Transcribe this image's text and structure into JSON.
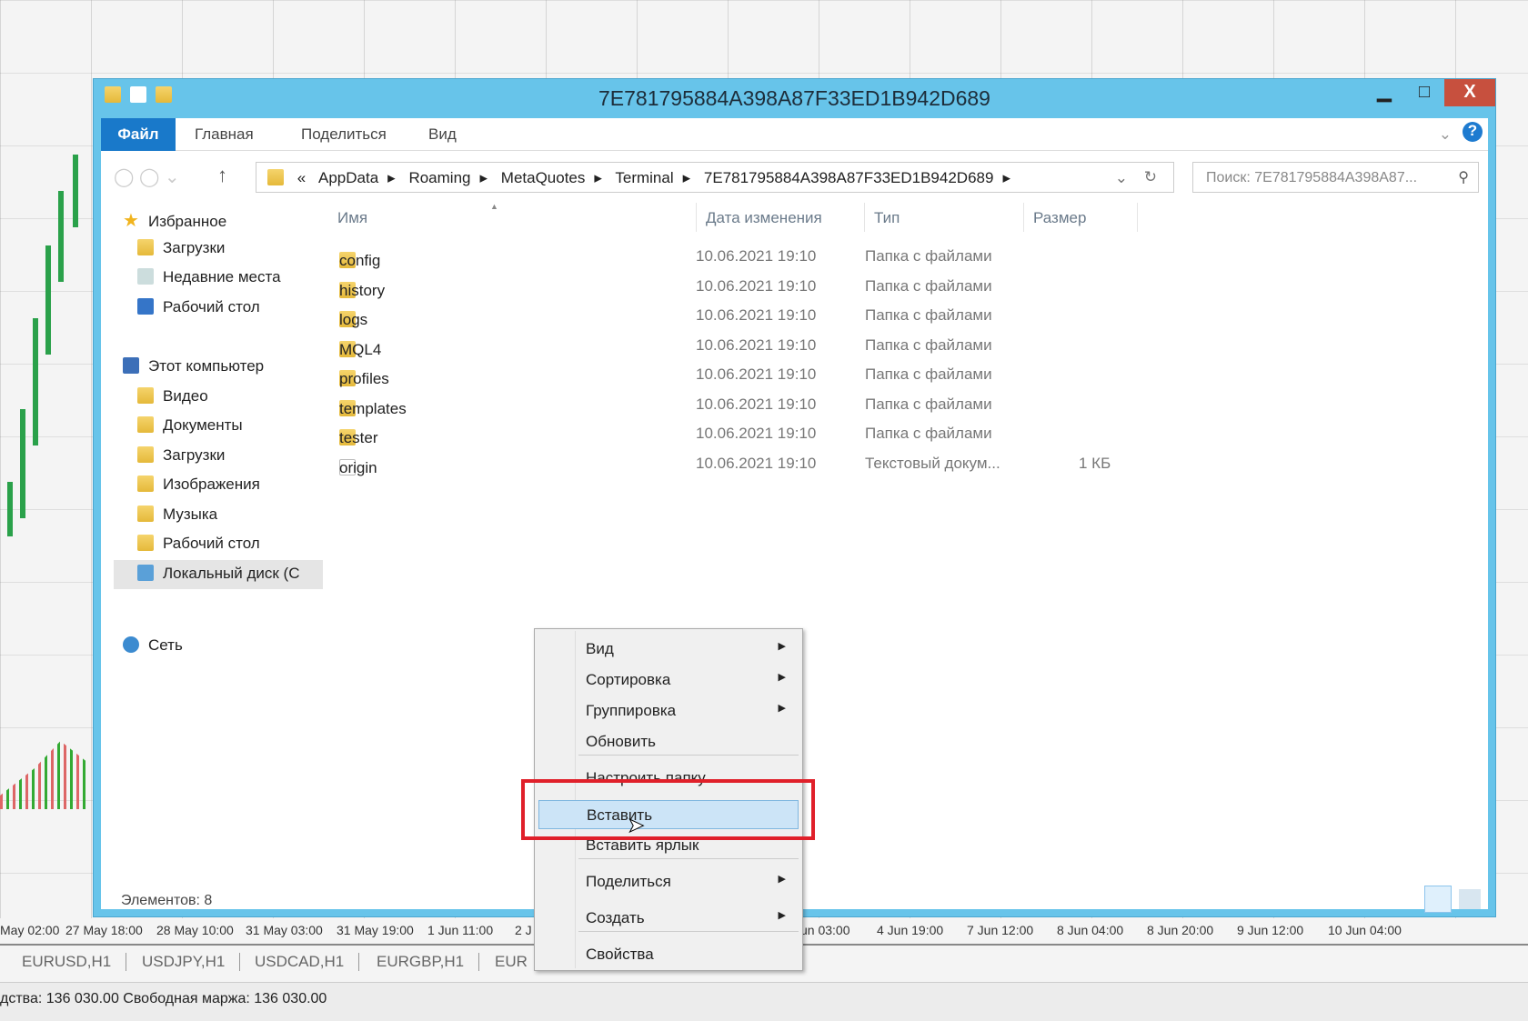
{
  "window": {
    "title": "7E781795884A398A87F33ED1B942D689",
    "minimize": "▁",
    "maximize": "□",
    "close": "X"
  },
  "ribbon": {
    "tabs": [
      "Файл",
      "Главная",
      "Поделиться",
      "Вид"
    ],
    "help": "?"
  },
  "address": {
    "prefix": "«",
    "parts": [
      "AppData",
      "Roaming",
      "MetaQuotes",
      "Terminal",
      "7E781795884A398A87F33ED1B942D689"
    ],
    "search_placeholder": "Поиск: 7E781795884A398A87..."
  },
  "sidebar": {
    "favorites": "Избранное",
    "fav_items": [
      "Загрузки",
      "Недавние места",
      "Рабочий стол"
    ],
    "computer": "Этот компьютер",
    "comp_items": [
      "Видео",
      "Документы",
      "Загрузки",
      "Изображения",
      "Музыка",
      "Рабочий стол",
      "Локальный диск (C"
    ],
    "network": "Сеть"
  },
  "columns": [
    "Имя",
    "Дата изменения",
    "Тип",
    "Размер"
  ],
  "files": [
    {
      "name": "config",
      "date": "10.06.2021 19:10",
      "type": "Папка с файлами",
      "size": "",
      "icon": "folder"
    },
    {
      "name": "history",
      "date": "10.06.2021 19:10",
      "type": "Папка с файлами",
      "size": "",
      "icon": "folder"
    },
    {
      "name": "logs",
      "date": "10.06.2021 19:10",
      "type": "Папка с файлами",
      "size": "",
      "icon": "folder"
    },
    {
      "name": "MQL4",
      "date": "10.06.2021 19:10",
      "type": "Папка с файлами",
      "size": "",
      "icon": "folder"
    },
    {
      "name": "profiles",
      "date": "10.06.2021 19:10",
      "type": "Папка с файлами",
      "size": "",
      "icon": "folder"
    },
    {
      "name": "templates",
      "date": "10.06.2021 19:10",
      "type": "Папка с файлами",
      "size": "",
      "icon": "folder"
    },
    {
      "name": "tester",
      "date": "10.06.2021 19:10",
      "type": "Папка с файлами",
      "size": "",
      "icon": "folder"
    },
    {
      "name": "origin",
      "date": "10.06.2021 19:10",
      "type": "Текстовый докум...",
      "size": "1 КБ",
      "icon": "file"
    }
  ],
  "status": "Элементов: 8",
  "context_menu": {
    "items": [
      "Вид",
      "Сортировка",
      "Группировка",
      "Обновить",
      "Настроить папку",
      "Вставить",
      "Вставить ярлык",
      "Поделиться",
      "Создать",
      "Свойства"
    ],
    "highlighted": "Вставить"
  },
  "timeline": [
    "May 02:00",
    "27 May 18:00",
    "28 May 10:00",
    "31 May 03:00",
    "31 May 19:00",
    "1 Jun 11:00",
    "2 J",
    "un 03:00",
    "4 Jun 19:00",
    "7 Jun 12:00",
    "8 Jun 04:00",
    "8 Jun 20:00",
    "9 Jun 12:00",
    "10 Jun 04:00"
  ],
  "chart_tabs": [
    "EURUSD,H1",
    "USDJPY,H1",
    "USDCAD,H1",
    "EURGBP,H1",
    "EUR"
  ],
  "terminal_status": "дства: 136 030.00  Свободная маржа: 136 030.00",
  "colors": {
    "titlebar": "#67c4ea",
    "file_tab": "#1979ca",
    "close": "#c7503e",
    "highlight": "#cce4f7",
    "annotation": "#e0202a"
  }
}
